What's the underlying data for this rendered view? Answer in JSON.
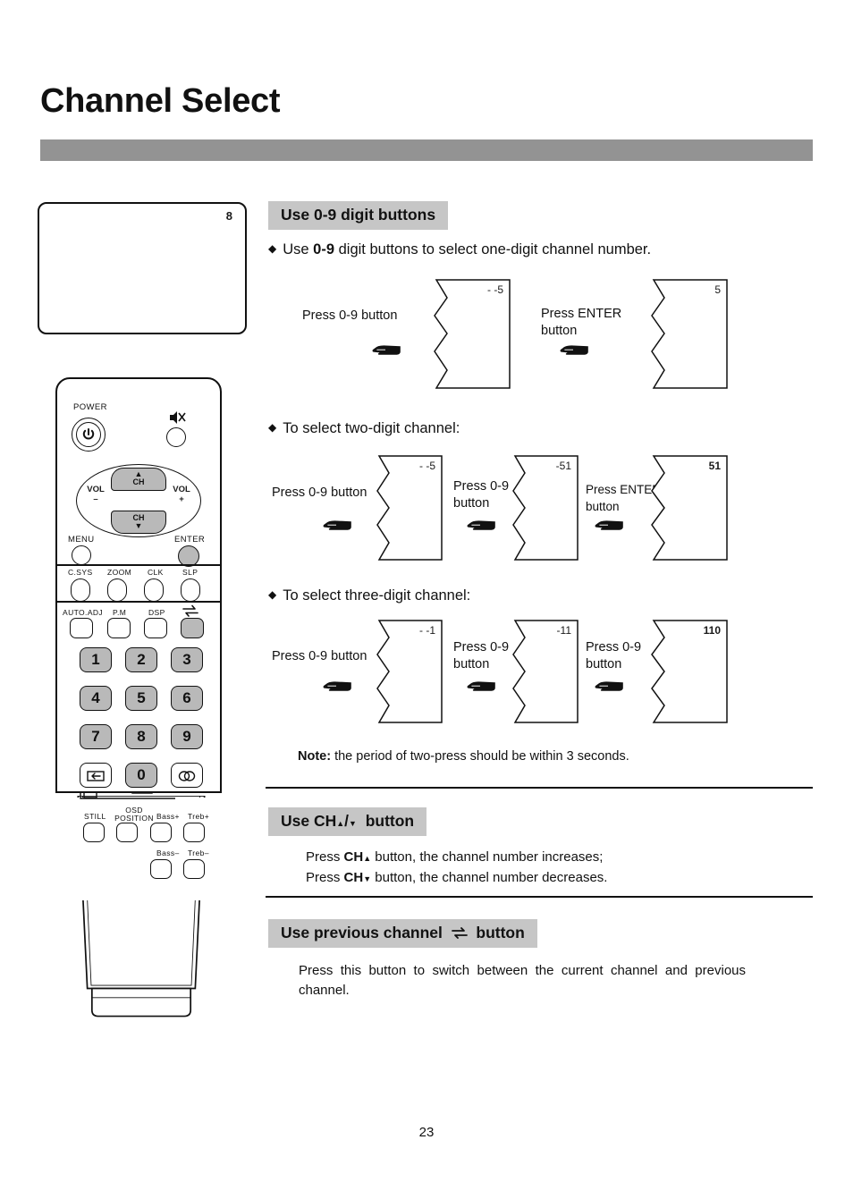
{
  "page": {
    "title": "Channel Select",
    "page_number": "23",
    "bar_color": "#939393",
    "heading_bg": "#c6c6c6"
  },
  "tv_preview": {
    "channel": "8"
  },
  "remote": {
    "power_label": "POWER",
    "power_icon": "power-icon",
    "mute_icon": "mute-icon",
    "dpad": {
      "ch_up": "CH",
      "ch_down": "CH",
      "vol_down_label": "VOL",
      "vol_down_sign": "–",
      "vol_up_label": "VOL",
      "vol_up_sign": "+"
    },
    "menu_label": "MENU",
    "enter_label": "ENTER",
    "row_csys": [
      "C.SYS",
      "ZOOM",
      "CLK",
      "SLP"
    ],
    "row_auto": [
      "AUTO.ADJ",
      "P.M",
      "DSP"
    ],
    "recall_icon": "recall-icon",
    "numpad": [
      [
        "1",
        "2",
        "3"
      ],
      [
        "4",
        "5",
        "6"
      ],
      [
        "7",
        "8",
        "9"
      ]
    ],
    "numpad_bottom": {
      "left_icon": "input-source-icon",
      "zero": "0",
      "right_icon": "stereo-icon"
    },
    "bottom_row1": [
      "STILL",
      "OSD POSITION",
      "Bass+",
      "Treb+"
    ],
    "bottom_row2": [
      "Bass–",
      "Treb–"
    ]
  },
  "sections": {
    "digits": {
      "heading": "Use 0-9 digit buttons",
      "bullet1_pre": "Use ",
      "bullet1_bold": "0-9",
      "bullet1_post": " digit buttons to select one-digit channel number.",
      "steps": [
        {
          "label_line1": "Press 0-9 button",
          "label_line2": "",
          "value": "- -5",
          "bold": false
        },
        {
          "label_line1": "Press ENTER",
          "label_line2": "button",
          "value": "5",
          "bold": false
        }
      ]
    },
    "two_digit": {
      "bullet": "To select two-digit channel:",
      "steps": [
        {
          "label_line1": "Press 0-9 button",
          "label_line2": "",
          "value": "- -5",
          "bold": false
        },
        {
          "label_line1": "Press 0-9",
          "label_line2": "button",
          "value": "-51",
          "bold": false
        },
        {
          "label_line1": "Press ENTER",
          "label_line2": "button",
          "value": "51",
          "bold": true
        }
      ]
    },
    "three_digit": {
      "bullet": "To select three-digit channel:",
      "steps": [
        {
          "label_line1": "Press 0-9 button",
          "label_line2": "",
          "value": "- -1",
          "bold": false
        },
        {
          "label_line1": "Press 0-9",
          "label_line2": "button",
          "value": "-11",
          "bold": false
        },
        {
          "label_line1": "Press 0-9",
          "label_line2": "button",
          "value": "110",
          "bold": true
        }
      ],
      "note_bold": "Note:",
      "note_rest": " the period of two-press should be within 3 seconds."
    },
    "ch_button": {
      "heading_pre": "Use CH",
      "heading_mid": "/",
      "heading_post": "button",
      "line1_pre": "Press ",
      "line1_bold": "CH",
      "line1_post": "button, the channel number increases;",
      "line2_pre": "Press ",
      "line2_bold": "CH",
      "line2_post": "button,  the channel number decreases."
    },
    "previous_channel": {
      "heading_pre": "Use previous channel",
      "heading_icon": "recall-icon",
      "heading_post": "button",
      "body": "Press this button to switch between the current channel and previous channel."
    }
  }
}
